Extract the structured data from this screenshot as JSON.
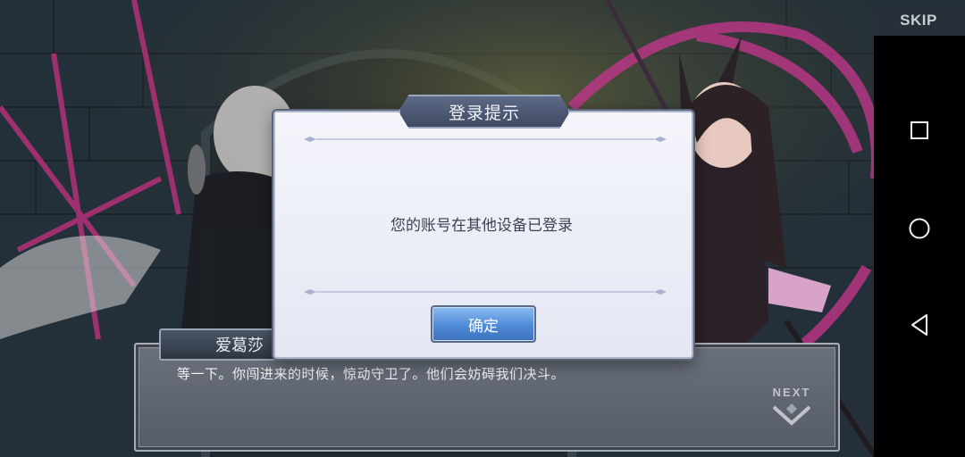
{
  "skip_label": "SKIP",
  "popup": {
    "title": "登录提示",
    "message": "您的账号在其他设备已登录",
    "confirm_label": "确定"
  },
  "dialogue": {
    "speaker": "爱葛莎",
    "text": "等一下。你闯进来的时候，惊动守卫了。他们会妨碍我们决斗。",
    "next_label": "NEXT"
  },
  "nav_bar": {
    "icons": [
      "recents-square-icon",
      "home-circle-icon",
      "back-triangle-icon"
    ]
  },
  "colors": {
    "confirm_button": "#4f8ad8",
    "popup_header": "#4a5670",
    "accent_magenta": "#b5307a"
  }
}
